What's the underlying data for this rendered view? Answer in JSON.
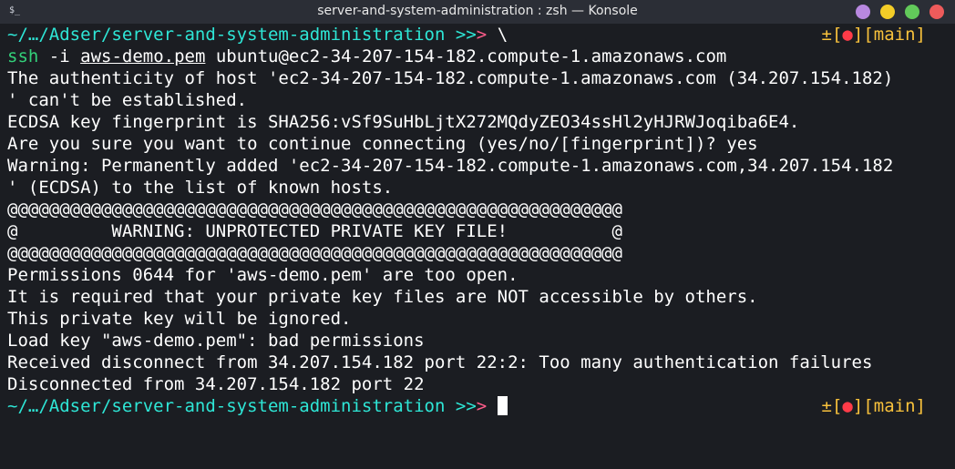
{
  "window": {
    "title": "server-and-system-administration : zsh — Konsole",
    "app_icon_glyph": "$_"
  },
  "prompt": {
    "path": "~/…/Adser/server-and-system-administration",
    "arrows_1": ">>",
    "arrows_2": ">",
    "continuation": "\\",
    "git_status_symbol": "±",
    "git_open": "[",
    "git_dot": "●",
    "git_close": "]",
    "git_branch_open": "[",
    "git_branch": "main",
    "git_branch_close": "]"
  },
  "command": {
    "cmd": "ssh",
    "flag": "-i",
    "keyfile": "aws-demo.pem",
    "target": "ubuntu@ec2-34-207-154-182.compute-1.amazonaws.com"
  },
  "output": [
    "The authenticity of host 'ec2-34-207-154-182.compute-1.amazonaws.com (34.207.154.182)",
    "' can't be established.",
    "ECDSA key fingerprint is SHA256:vSf9SuHbLjtX272MQdyZEO34ssHl2yHJRWJoqiba6E4.",
    "Are you sure you want to continue connecting (yes/no/[fingerprint])? yes",
    "Warning: Permanently added 'ec2-34-207-154-182.compute-1.amazonaws.com,34.207.154.182",
    "' (ECDSA) to the list of known hosts.",
    "@@@@@@@@@@@@@@@@@@@@@@@@@@@@@@@@@@@@@@@@@@@@@@@@@@@@@@@@@@@",
    "@         WARNING: UNPROTECTED PRIVATE KEY FILE!          @",
    "@@@@@@@@@@@@@@@@@@@@@@@@@@@@@@@@@@@@@@@@@@@@@@@@@@@@@@@@@@@",
    "Permissions 0644 for 'aws-demo.pem' are too open.",
    "It is required that your private key files are NOT accessible by others.",
    "This private key will be ignored.",
    "Load key \"aws-demo.pem\": bad permissions",
    "Received disconnect from 34.207.154.182 port 22:2: Too many authentication failures",
    "Disconnected from 34.207.154.182 port 22"
  ]
}
